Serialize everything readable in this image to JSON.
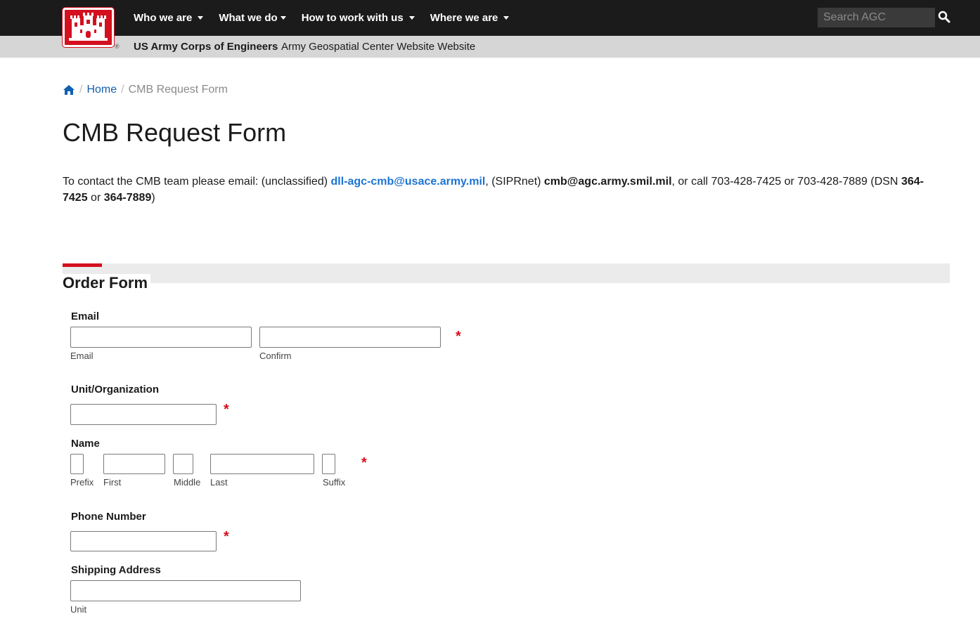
{
  "header": {
    "nav": [
      {
        "label": "Who we are"
      },
      {
        "label": "What we do"
      },
      {
        "label": "How to work with us"
      },
      {
        "label": "Where we are"
      }
    ],
    "search_placeholder": "Search AGC",
    "registered_mark": "®"
  },
  "subbar": {
    "org": "US Army Corps of Engineers",
    "site": "Army Geospatial Center Website Website"
  },
  "breadcrumb": {
    "sep": "/",
    "home": "Home",
    "current": "CMB Request Form"
  },
  "page_title": "CMB Request Form",
  "contact": {
    "prefix": "To contact the CMB team please email: (unclassified) ",
    "email_unclass": "dll-agc-cmb@usace.army.mil",
    "mid1": ", (SIPRnet) ",
    "email_sipr": "cmb@agc.army.smil.mil",
    "mid2": ", or call 703-428-7425 or 703-428-7889 (DSN ",
    "dsn1": "364-7425",
    "mid3": " or ",
    "dsn2": "364-7889",
    "suffix": ")"
  },
  "form": {
    "title": "Order Form",
    "required_mark": "*",
    "email": {
      "label": "Email",
      "sub1": "Email",
      "sub2": "Confirm"
    },
    "unit": {
      "label": "Unit/Organization"
    },
    "name": {
      "label": "Name",
      "prefix": "Prefix",
      "first": "First",
      "middle": "Middle",
      "last": "Last",
      "suffix": "Suffix"
    },
    "phone": {
      "label": "Phone Number"
    },
    "shipping": {
      "label": "Shipping Address",
      "sub1": "Unit"
    }
  },
  "colors": {
    "brand_red": "#d4101e",
    "link_blue": "#1b74d4",
    "nav_bg": "#1b1b1b"
  }
}
